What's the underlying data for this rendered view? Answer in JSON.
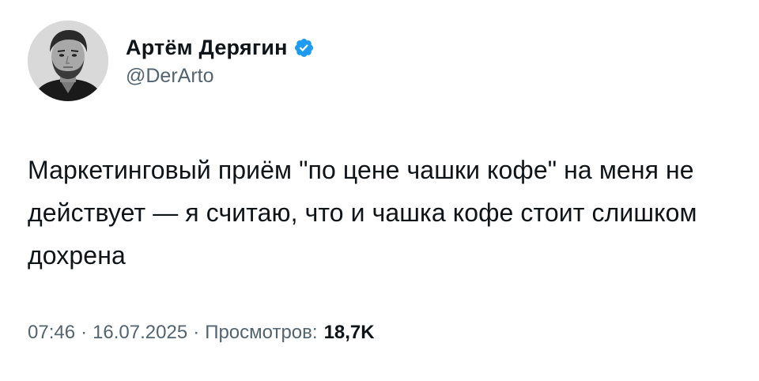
{
  "author": {
    "display_name": "Артём Дерягин",
    "handle": "@DerArto",
    "avatar_icon": "avatar-photo",
    "verified_icon": "verified-badge-icon",
    "verified_color": "#1d9bf0"
  },
  "tweet": {
    "text": "Маркетинговый приём \"по цене чашки кофе\" на меня не действует — я считаю, что и чашка кофе стоит слишком дохрена",
    "time": "07:46",
    "separator": "·",
    "date": "16.07.2025",
    "views_label": "Просмотров:",
    "views_count": "18,7K"
  },
  "colors": {
    "text": "#0f1419",
    "secondary": "#536471",
    "background": "#ffffff"
  }
}
